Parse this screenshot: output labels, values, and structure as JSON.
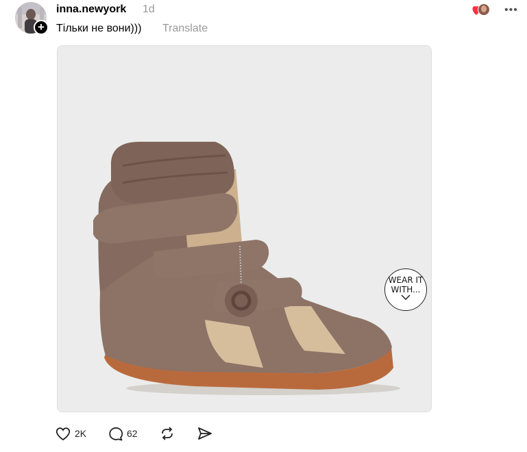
{
  "post": {
    "username": "inna.newyork",
    "time": "1d",
    "caption": "Тільки не вони)))",
    "translate_label": "Translate",
    "media_badge": {
      "line1": "WEAR IT",
      "line2": "WITH..."
    }
  },
  "actions": {
    "likes": "2K",
    "replies": "62"
  },
  "icons": {
    "follow": "plus-icon",
    "like": "heart-icon",
    "reply": "comment-icon",
    "repost": "repost-icon",
    "share": "send-icon",
    "more": "more-icon"
  },
  "colors": {
    "muted_text": "#999999",
    "liked_heart": "#ff3040",
    "shoe_suede": "#8a6f64",
    "shoe_sole": "#b8693a"
  }
}
